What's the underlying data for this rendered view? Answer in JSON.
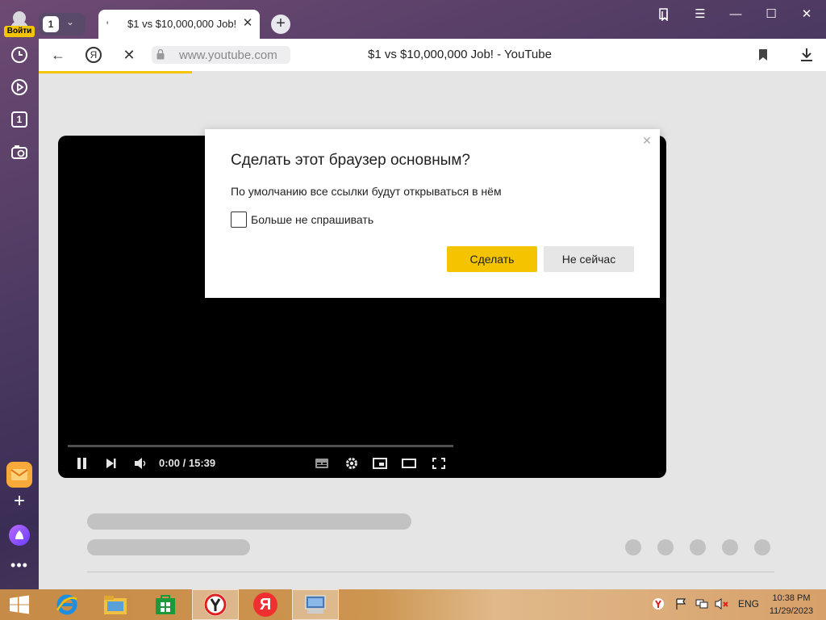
{
  "sidebar": {
    "login_label": "Войти",
    "tab_count": "1",
    "icons": [
      "history-icon",
      "play-icon",
      "tab-count-icon",
      "camera-icon",
      "mail-icon",
      "add-icon",
      "alice-icon",
      "more-icon"
    ]
  },
  "tabstrip": {
    "tab_counter": "1",
    "tab_title": "$1 vs $10,000,000 Job! -",
    "tab_favicon": "ꞌ",
    "close_glyph": "✕",
    "new_tab_glyph": "+"
  },
  "toolbar": {
    "url": "www.youtube.com",
    "page_title": "$1 vs $10,000,000 Job! - YouTube",
    "yandex_letter": "Я"
  },
  "player": {
    "time": "0:00 / 15:39"
  },
  "dialog": {
    "title": "Сделать этот браузер основным?",
    "text": "По умолчанию все ссылки будут открываться в нём",
    "checkbox_label": "Больше не спрашивать",
    "checkbox_checked": false,
    "primary_button": "Сделать",
    "secondary_button": "Не сейчас",
    "close_glyph": "✕"
  },
  "taskbar": {
    "yandex_letter": "Я",
    "language": "ENG",
    "time": "10:38 PM",
    "date": "11/29/2023"
  },
  "colors": {
    "accent": "#f4c400",
    "taskbar": "#c78b48"
  }
}
